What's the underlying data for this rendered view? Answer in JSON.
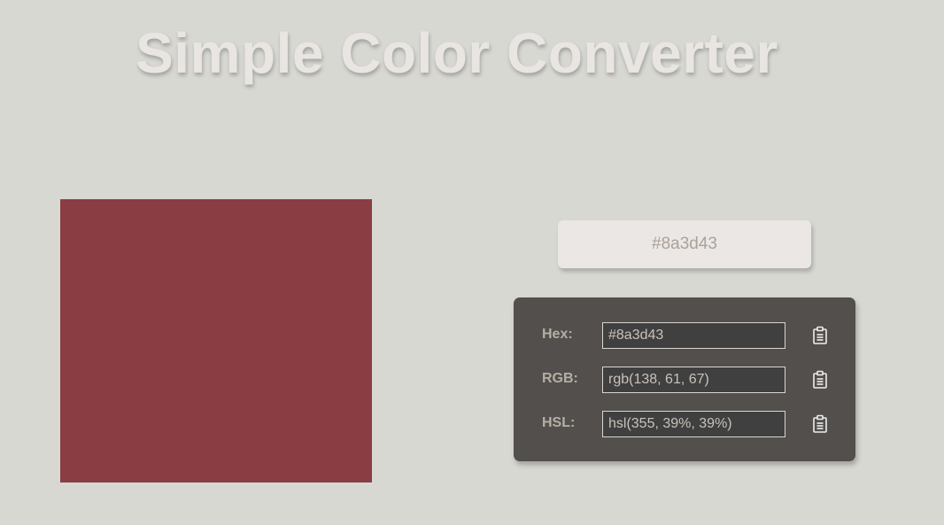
{
  "title": "Simple Color Converter",
  "color": {
    "hex": "#8a3d43"
  },
  "picker": {
    "value": "#8a3d43"
  },
  "formats": [
    {
      "label": "Hex:",
      "value": "#8a3d43",
      "icon": "clipboard-icon"
    },
    {
      "label": "RGB:",
      "value": "rgb(138, 61, 67)",
      "icon": "clipboard-icon"
    },
    {
      "label": "HSL:",
      "value": "hsl(355, 39%, 39%)",
      "icon": "clipboard-icon"
    }
  ],
  "colors": {
    "background": "#d8d8d2",
    "title": "#e8e5e3",
    "panel": "#524f4c",
    "input_bg": "#404040",
    "label": "#b5aea3"
  }
}
